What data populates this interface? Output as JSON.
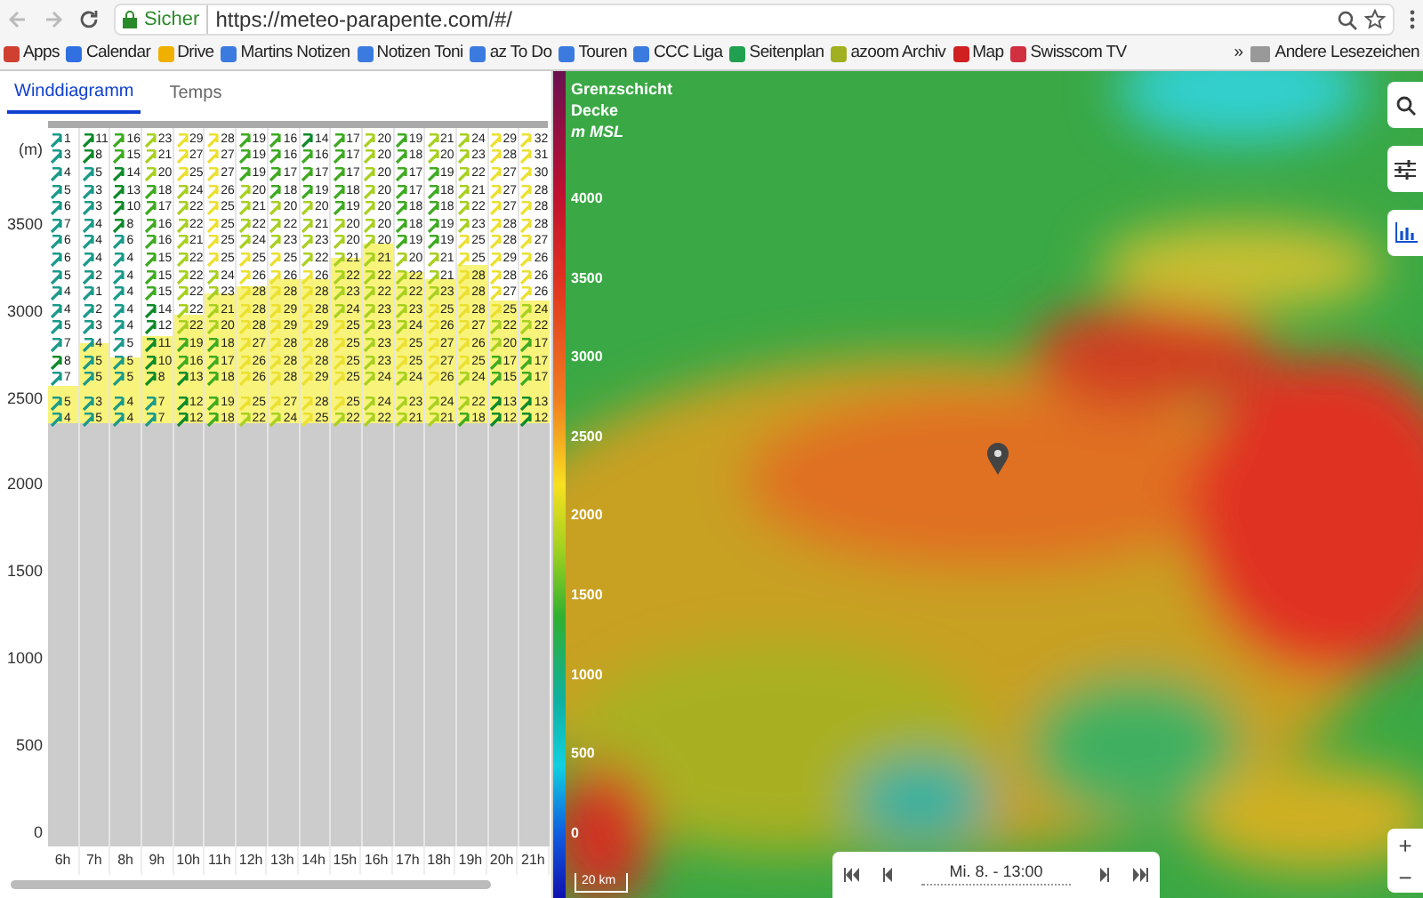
{
  "browser": {
    "secure_label": "Sicher",
    "url": "https://meteo-parapente.com/#/",
    "bookmarks": [
      "Apps",
      "Calendar",
      "Drive",
      "Martins Notizen",
      "Notizen Toni",
      "az To Do",
      "Touren",
      "CCC Liga",
      "Seitenplan",
      "azoom Archiv",
      "Map",
      "Swisscom TV"
    ],
    "more": "»",
    "other_bookmarks": "Andere Lesezeichen"
  },
  "tabs": [
    {
      "label": "Winddiagramm",
      "selected": true
    },
    {
      "label": "Temps",
      "selected": false
    }
  ],
  "wind_diagram": {
    "unit_label": "(m)",
    "altitude_labels": [
      "3500",
      "3000",
      "2500",
      "2000",
      "1500",
      "1000",
      "500",
      "0"
    ],
    "hours": [
      {
        "label": "6h",
        "level": 0.64
      },
      {
        "label": "7h",
        "level": 0.7
      },
      {
        "label": "8h",
        "level": 0.68
      },
      {
        "label": "9h",
        "level": 0.71
      },
      {
        "label": "10h",
        "level": 0.74
      },
      {
        "label": "11h",
        "level": 0.77
      },
      {
        "label": "12h",
        "level": 0.78
      },
      {
        "label": "13h",
        "level": 0.79
      },
      {
        "label": "14h",
        "level": 0.79
      },
      {
        "label": "15h",
        "level": 0.82
      },
      {
        "label": "16h",
        "level": 0.84
      },
      {
        "label": "17h",
        "level": 0.8
      },
      {
        "label": "18h",
        "level": 0.79
      },
      {
        "label": "19h",
        "level": 0.81
      },
      {
        "label": "20h",
        "level": 0.76
      },
      {
        "label": "21h",
        "level": 0.76
      }
    ],
    "rows": [
      [
        "1",
        "11",
        "16",
        "23",
        "29",
        "28",
        "19",
        "16",
        "14",
        "17",
        "20",
        "19",
        "21",
        "24",
        "29",
        "32"
      ],
      [
        "3",
        "8",
        "15",
        "21",
        "27",
        "27",
        "19",
        "16",
        "16",
        "17",
        "20",
        "18",
        "20",
        "23",
        "28",
        "31"
      ],
      [
        "4",
        "5",
        "14",
        "20",
        "25",
        "27",
        "19",
        "17",
        "17",
        "17",
        "20",
        "17",
        "19",
        "22",
        "27",
        "30"
      ],
      [
        "5",
        "3",
        "13",
        "18",
        "24",
        "26",
        "20",
        "18",
        "19",
        "18",
        "20",
        "17",
        "18",
        "21",
        "27",
        "28"
      ],
      [
        "6",
        "3",
        "10",
        "17",
        "22",
        "25",
        "21",
        "20",
        "20",
        "19",
        "20",
        "18",
        "18",
        "22",
        "27",
        "28"
      ],
      [
        "7",
        "4",
        "8",
        "16",
        "22",
        "25",
        "22",
        "22",
        "21",
        "20",
        "20",
        "18",
        "19",
        "23",
        "28",
        "28"
      ],
      [
        "6",
        "4",
        "6",
        "16",
        "21",
        "25",
        "24",
        "23",
        "23",
        "20",
        "20",
        "19",
        "19",
        "25",
        "28",
        "27"
      ],
      [
        "6",
        "4",
        "4",
        "15",
        "22",
        "25",
        "25",
        "25",
        "22",
        "21",
        "21",
        "20",
        "21",
        "25",
        "29",
        "26"
      ],
      [
        "5",
        "2",
        "4",
        "15",
        "22",
        "24",
        "26",
        "26",
        "26",
        "22",
        "22",
        "22",
        "21",
        "28",
        "28",
        "26"
      ],
      [
        "4",
        "1",
        "4",
        "15",
        "22",
        "23",
        "28",
        "28",
        "28",
        "23",
        "22",
        "22",
        "23",
        "28",
        "27",
        "26"
      ],
      [
        "4",
        "2",
        "4",
        "14",
        "22",
        "21",
        "28",
        "29",
        "28",
        "24",
        "23",
        "23",
        "25",
        "28",
        "25",
        "24"
      ],
      [
        "5",
        "3",
        "4",
        "12",
        "22",
        "20",
        "28",
        "29",
        "29",
        "25",
        "23",
        "24",
        "26",
        "27",
        "22",
        "22"
      ],
      [
        "7",
        "4",
        "5",
        "11",
        "19",
        "18",
        "27",
        "28",
        "28",
        "25",
        "23",
        "25",
        "27",
        "26",
        "20",
        "17"
      ],
      [
        "8",
        "5",
        "5",
        "10",
        "16",
        "17",
        "26",
        "28",
        "28",
        "25",
        "23",
        "25",
        "27",
        "25",
        "17",
        "17"
      ],
      [
        "7",
        "5",
        "5",
        "8",
        "13",
        "18",
        "26",
        "28",
        "29",
        "25",
        "24",
        "24",
        "26",
        "24",
        "15",
        "17"
      ],
      [
        "5",
        "3",
        "4",
        "7",
        "12",
        "19",
        "25",
        "27",
        "28",
        "25",
        "24",
        "23",
        "24",
        "22",
        "13",
        "13"
      ],
      [
        "4",
        "5",
        "4",
        "7",
        "12",
        "18",
        "22",
        "24",
        "25",
        "22",
        "22",
        "21",
        "21",
        "18",
        "12",
        "12"
      ]
    ]
  },
  "map": {
    "legend": {
      "title_lines": [
        "Grenzschicht",
        "Decke"
      ],
      "unit": "m MSL",
      "scale_labels": [
        "4000",
        "3500",
        "3000",
        "2500",
        "2000",
        "1500",
        "1000",
        "500",
        "0"
      ]
    },
    "scale_bar": "20 km",
    "zoom_in": "+",
    "zoom_out": "−",
    "time": "Mi. 8. - 13:00"
  }
}
